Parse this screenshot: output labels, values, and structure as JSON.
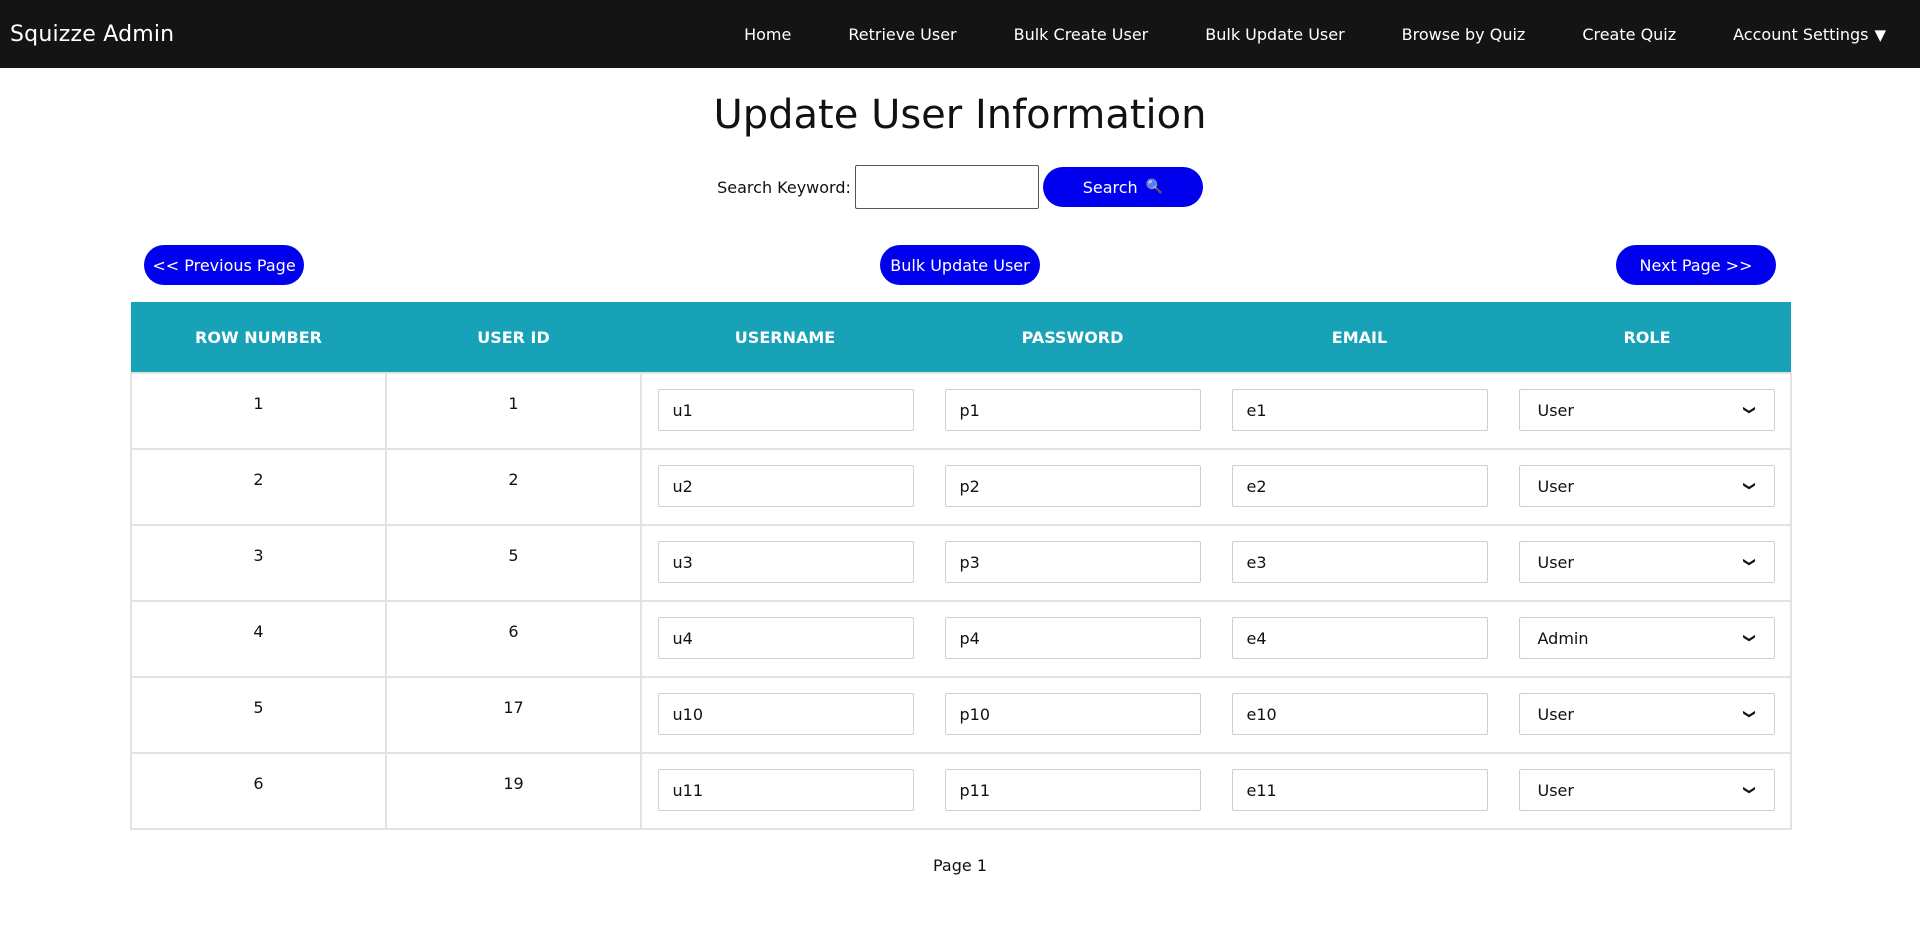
{
  "navbar": {
    "brand": "Squizze Admin",
    "links": [
      "Home",
      "Retrieve User",
      "Bulk Create User",
      "Bulk Update User",
      "Browse by Quiz",
      "Create Quiz"
    ],
    "account_label": "Account Settings",
    "account_caret": "▼",
    "background": "#141414"
  },
  "page": {
    "title": "Update User Information"
  },
  "search": {
    "label": "Search Keyword:",
    "value": "",
    "button_label": "Search",
    "button_icon": "🔍",
    "accent": "#0000ee"
  },
  "pager": {
    "prev_label": "<< Previous Page",
    "bulk_label": "Bulk Update User",
    "next_label": "Next Page >>",
    "page_indicator": "Page 1"
  },
  "table": {
    "header_color": "#17a2b8",
    "columns": [
      "Row Number",
      "User ID",
      "Username",
      "Password",
      "Email",
      "Role"
    ],
    "rows": [
      {
        "row": "1",
        "user_id": "1",
        "username": "u1",
        "password": "p1",
        "email": "e1",
        "role": "User"
      },
      {
        "row": "2",
        "user_id": "2",
        "username": "u2",
        "password": "p2",
        "email": "e2",
        "role": "User"
      },
      {
        "row": "3",
        "user_id": "5",
        "username": "u3",
        "password": "p3",
        "email": "e3",
        "role": "User"
      },
      {
        "row": "4",
        "user_id": "6",
        "username": "u4",
        "password": "p4",
        "email": "e4",
        "role": "Admin"
      },
      {
        "row": "5",
        "user_id": "17",
        "username": "u10",
        "password": "p10",
        "email": "e10",
        "role": "User"
      },
      {
        "row": "6",
        "user_id": "19",
        "username": "u11",
        "password": "p11",
        "email": "e11",
        "role": "User"
      }
    ]
  }
}
